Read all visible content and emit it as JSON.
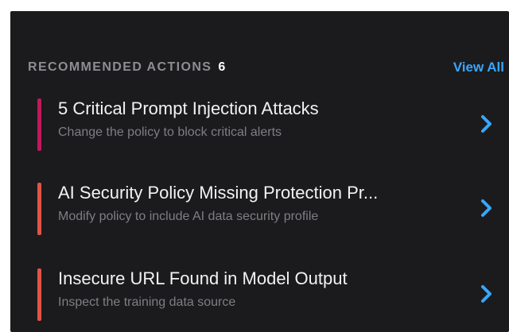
{
  "recommended": {
    "title": "RECOMMENDED ACTIONS",
    "count": "6",
    "view_all_label": "View All",
    "items": [
      {
        "title": "5 Critical Prompt Injection Attacks",
        "subtitle": "Change the policy to block critical alerts",
        "accent_color": "#c2185b",
        "icon": "chevron-right-icon"
      },
      {
        "title": "AI Security Policy Missing Protection Pr...",
        "subtitle": "Modify policy to include AI data security profile",
        "accent_color": "#e05548",
        "icon": "chevron-right-icon"
      },
      {
        "title": "Insecure URL Found in Model Output",
        "subtitle": "Inspect the training data source",
        "accent_color": "#e05548",
        "icon": "chevron-right-icon"
      }
    ]
  },
  "colors": {
    "background": "#1b1b1d",
    "link": "#39a6ff",
    "chevron": "#39a6ff"
  }
}
